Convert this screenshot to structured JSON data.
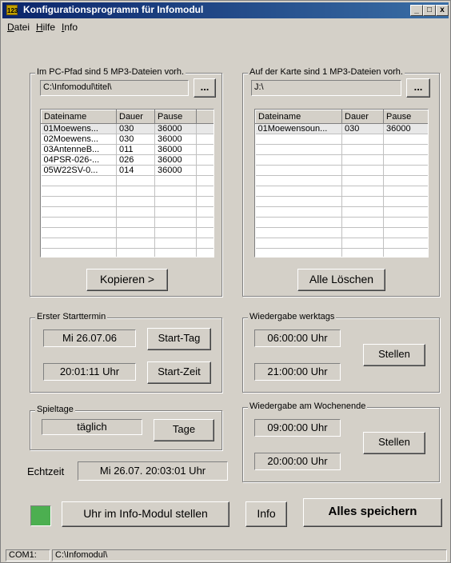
{
  "window": {
    "title": "Konfigurationsprogramm für  Infomodul",
    "app_icon": "123-icon",
    "controls": {
      "minimize": "_",
      "maximize": "□",
      "close": "x"
    }
  },
  "menu": {
    "datei_u": "D",
    "datei_rest": "atei",
    "hilfe_u": "H",
    "hilfe_rest": "ilfe",
    "info_u": "I",
    "info_rest": "nfo"
  },
  "pc_group": {
    "title": "Im PC-Pfad sind 5 MP3-Dateien vorh.",
    "path": "C:\\Infomodul\\titel\\",
    "browse_label": "...",
    "columns": [
      "Dateiname",
      "Dauer",
      "Pause"
    ],
    "rows": [
      [
        "01Moewens...",
        "030",
        "36000"
      ],
      [
        "02Moewens...",
        "030",
        "36000"
      ],
      [
        "03AntenneB...",
        "011",
        "36000"
      ],
      [
        "04PSR-026-...",
        "026",
        "36000"
      ],
      [
        "05W22SV-0...",
        "014",
        "36000"
      ]
    ],
    "copy_label": "Kopieren >"
  },
  "card_group": {
    "title": "Auf der Karte sind 1 MP3-Dateien vorh.",
    "path": "J:\\",
    "browse_label": "...",
    "columns": [
      "Dateiname",
      "Dauer",
      "Pause"
    ],
    "rows": [
      [
        "01Moewensoun...",
        "030",
        "36000"
      ]
    ],
    "delete_label": "Alle Löschen"
  },
  "start_group": {
    "title": "Erster Starttermin",
    "date": "Mi 26.07.06",
    "time": "20:01:11 Uhr",
    "start_day_label": "Start-Tag",
    "start_time_label": "Start-Zeit"
  },
  "weekday_group": {
    "title": "Wiedergabe werktags",
    "from": "06:00:00 Uhr",
    "to": "21:00:00 Uhr",
    "set_label": "Stellen"
  },
  "playdays_group": {
    "title": "Spieltage",
    "value": "täglich",
    "days_label": "Tage"
  },
  "weekend_group": {
    "title": "Wiedergabe am Wochenende",
    "from": "09:00:00 Uhr",
    "to": "20:00:00 Uhr",
    "set_label": "Stellen"
  },
  "realtime": {
    "label": "Echtzeit",
    "value": "Mi 26.07. 20:03:01 Uhr"
  },
  "bottom": {
    "indicator_color": "#4caf50",
    "set_clock_label": "Uhr im Info-Modul stellen",
    "info_label": "Info",
    "save_all_label": "Alles speichern"
  },
  "status": {
    "port": "COM1:",
    "path": "C:\\Infomodul\\"
  }
}
